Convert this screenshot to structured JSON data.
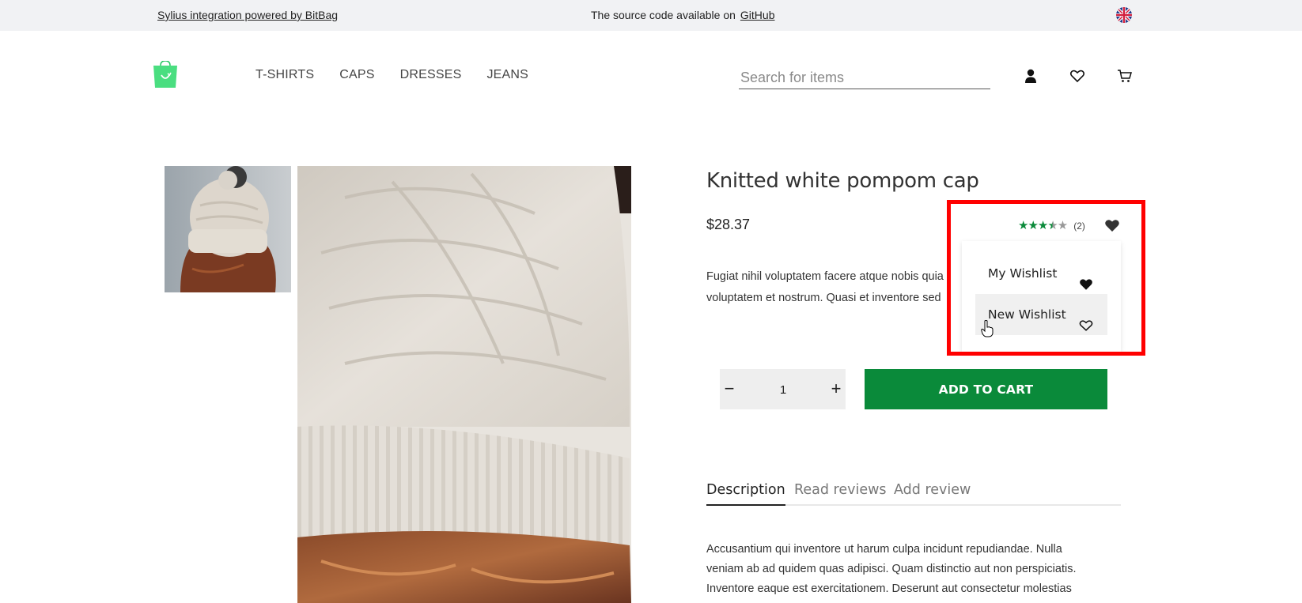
{
  "topbar": {
    "left_link": "Sylius integration powered by BitBag",
    "source_text": "The source code available on",
    "source_link": "GitHub",
    "language_icon": "uk-flag-icon"
  },
  "header": {
    "logo_icon": "shopping-bag-logo-icon",
    "nav": [
      "T-SHIRTS",
      "CAPS",
      "DRESSES",
      "JEANS"
    ],
    "search_placeholder": "Search for items",
    "icons": [
      "user-icon",
      "heart-icon",
      "cart-icon"
    ]
  },
  "product": {
    "title": "Knitted white pompom cap",
    "price": "$28.37",
    "rating": {
      "stars": 3.5,
      "max": 5,
      "count_label": "(2)"
    },
    "description_line1": "Fugiat nihil voluptatem facere atque nobis quia",
    "description_line2": "voluptatem et nostrum. Quasi et inventore sed",
    "quantity": "1",
    "quantity_minus": "−",
    "quantity_plus": "+",
    "add_to_cart": "ADD TO CART"
  },
  "wishlist_dropdown": {
    "items": [
      {
        "label": "My Wishlist",
        "icon": "heart-filled-icon"
      },
      {
        "label": "New Wishlist",
        "icon": "heart-outline-icon"
      }
    ]
  },
  "tabs": {
    "items": [
      "Description",
      "Read reviews",
      "Add review"
    ],
    "active": "Description"
  },
  "tab_content": {
    "line1": "Accusantium qui inventore ut harum culpa incidunt repudiandae. Nulla",
    "line2": "veniam ab ad quidem quas adipisci. Quam distinctio aut non perspiciatis.",
    "line3": "Inventore eaque est exercitationem. Deserunt aut consectetur molestias"
  },
  "colors": {
    "accent_green": "#0a8a3a",
    "logo_green": "#4ade80",
    "highlight_red": "#ff0000",
    "topbar_bg": "#f1f2f4"
  }
}
